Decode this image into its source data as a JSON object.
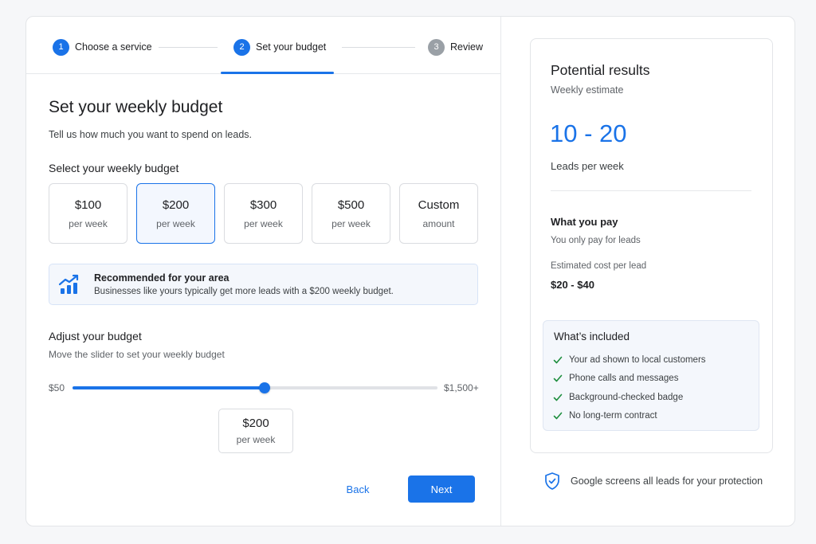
{
  "stepper": {
    "steps": [
      {
        "num": "1",
        "label": "Choose a service"
      },
      {
        "num": "2",
        "label": "Set your budget"
      },
      {
        "num": "3",
        "label": "Review"
      }
    ]
  },
  "main": {
    "title": "Set your weekly budget",
    "subtitle": "Tell us how much you want to spend on leads.",
    "select_label": "Select your weekly budget",
    "options": [
      {
        "amount": "$100",
        "per": "per week",
        "selected": false
      },
      {
        "amount": "$200",
        "per": "per week",
        "selected": true
      },
      {
        "amount": "$300",
        "per": "per week",
        "selected": false
      },
      {
        "amount": "$500",
        "per": "per week",
        "selected": false
      },
      {
        "amount": "Custom",
        "per": "amount",
        "selected": false
      }
    ],
    "recommendation": {
      "title": "Recommended for your area",
      "text": "Businesses like yours typically get more leads with a $200 weekly budget."
    },
    "slider": {
      "label": "Adjust your budget",
      "description": "Move the slider to set your weekly budget",
      "min_label": "$50",
      "max_label": "$1,500+",
      "fraction": 0.526
    },
    "current_value": {
      "amount": "$200",
      "per": "per week"
    },
    "back_label": "Back",
    "next_label": "Next"
  },
  "results": {
    "title": "Potential results",
    "subtitle": "Weekly estimate",
    "range": "10 - 20",
    "range_label": "Leads per week",
    "pay_title": "What you pay",
    "pay_sub": "You only pay for leads",
    "cost_label": "Estimated cost per lead",
    "cost_value": "$20 - $40",
    "included_title": "What’s included",
    "included_items": [
      "Your ad shown to local customers",
      "Phone calls and messages",
      "Background-checked badge",
      "No long-term contract"
    ]
  },
  "footer": {
    "protection_text": "Google screens all leads for your protection"
  },
  "colors": {
    "accent": "#1a73e8",
    "check": "#1e8e3e",
    "muted_step": "#9aa0a6"
  },
  "icons": [
    "trending-up-chart-icon",
    "check-icon",
    "shield-check-icon"
  ]
}
